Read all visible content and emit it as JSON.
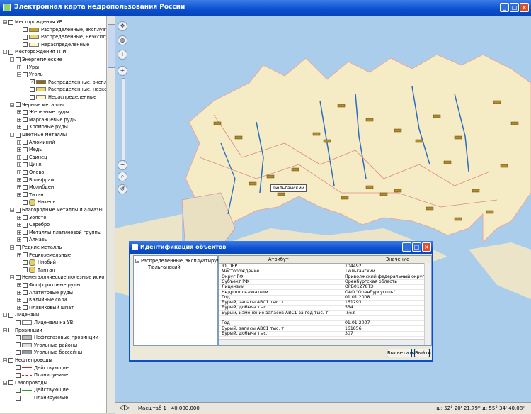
{
  "window": {
    "title": "Электронная карта недропользования России"
  },
  "tree": [
    {
      "label": "Месторождения УВ",
      "level": 0,
      "exp": "−"
    },
    {
      "label": "Распределенные, эксплуатируемые",
      "level": 2,
      "swatch": "#c9a020"
    },
    {
      "label": "Распределенные, неэксплуатируемые",
      "level": 2,
      "swatch": "#f0d860"
    },
    {
      "label": "Нераспределенные",
      "level": 2,
      "swatch": "#fff8c8"
    },
    {
      "label": "Месторождения ТПИ",
      "level": 0,
      "exp": "−"
    },
    {
      "label": "Энергетические",
      "level": 1,
      "exp": "−"
    },
    {
      "label": "Уран",
      "level": 2,
      "exp": "+"
    },
    {
      "label": "Уголь",
      "level": 2,
      "exp": "−"
    },
    {
      "label": "Распределенные, эксплуатируемые",
      "level": 3,
      "swatch": "#8a6a1a",
      "checked": true
    },
    {
      "label": "Распределенные, неэксплуатируемые",
      "level": 3,
      "swatch": "#f0d860"
    },
    {
      "label": "Нераспределенные",
      "level": 3,
      "swatch": "#fff8c8"
    },
    {
      "label": "Черные металлы",
      "level": 1,
      "exp": "−"
    },
    {
      "label": "Железные руды",
      "level": 2,
      "exp": "+"
    },
    {
      "label": "Марганцевые руды",
      "level": 2,
      "exp": "+"
    },
    {
      "label": "Хромовые руды",
      "level": 2,
      "exp": "+"
    },
    {
      "label": "Цветные металлы",
      "level": 1,
      "exp": "−"
    },
    {
      "label": "Алюминий",
      "level": 2,
      "exp": "+"
    },
    {
      "label": "Медь",
      "level": 2,
      "exp": "+"
    },
    {
      "label": "Свинец",
      "level": 2,
      "exp": "+"
    },
    {
      "label": "Цинк",
      "level": 2,
      "exp": "+"
    },
    {
      "label": "Олово",
      "level": 2,
      "exp": "+"
    },
    {
      "label": "Вольфрам",
      "level": 2,
      "exp": "+"
    },
    {
      "label": "Молибден",
      "level": 2,
      "exp": "+"
    },
    {
      "label": "Титан",
      "level": 2,
      "exp": "+"
    },
    {
      "label": "Никель",
      "level": 2,
      "swatch": "#e8d060",
      "round": true
    },
    {
      "label": "Благородные металлы и алмазы",
      "level": 1,
      "exp": "−"
    },
    {
      "label": "Золото",
      "level": 2,
      "exp": "+"
    },
    {
      "label": "Серебро",
      "level": 2,
      "exp": "+"
    },
    {
      "label": "Металлы платиновой группы",
      "level": 2,
      "exp": "+"
    },
    {
      "label": "Алмазы",
      "level": 2,
      "exp": "+"
    },
    {
      "label": "Редкие металлы",
      "level": 1,
      "exp": "−"
    },
    {
      "label": "Редкоземельные",
      "level": 2,
      "exp": "+"
    },
    {
      "label": "Ниобий",
      "level": 2,
      "swatch": "#e8d060",
      "round": true
    },
    {
      "label": "Тантал",
      "level": 2,
      "swatch": "#e8d060",
      "round": true
    },
    {
      "label": "Неметаллические полезные ископаемые",
      "level": 1,
      "exp": "−"
    },
    {
      "label": "Фосфоритовые руды",
      "level": 2,
      "exp": "+"
    },
    {
      "label": "Апатитовые руды",
      "level": 2,
      "exp": "+"
    },
    {
      "label": "Калийные соли",
      "level": 2,
      "exp": "+"
    },
    {
      "label": "Плавиковый шпат",
      "level": 2,
      "exp": "+"
    },
    {
      "label": "Лицензии",
      "level": 0,
      "exp": "−"
    },
    {
      "label": "Лицензии на УВ",
      "level": 1,
      "swatch": "#ffffff"
    },
    {
      "label": "Провинции",
      "level": 0,
      "exp": "−"
    },
    {
      "label": "Нефтегазовые провинции",
      "level": 1,
      "swatch": "#bbbbbb"
    },
    {
      "label": "Угольные районы",
      "level": 1,
      "swatch": "#e0e0e0"
    },
    {
      "label": "Угольные бассейны",
      "level": 1,
      "swatch": "#999999"
    },
    {
      "label": "Нефтепроводы",
      "level": 0,
      "exp": "−"
    },
    {
      "label": "Действующие",
      "level": 1,
      "line": "#cc2222"
    },
    {
      "label": "Планируемые",
      "level": 1,
      "line": "#cc2222",
      "dashed": true
    },
    {
      "label": "Газопроводы",
      "level": 0,
      "exp": "−"
    },
    {
      "label": "Действующие",
      "level": 1,
      "line": "#2a9a2a"
    },
    {
      "label": "Планируемые",
      "level": 1,
      "line": "#2a9a2a",
      "dashed": true
    }
  ],
  "map": {
    "popup_label": "Тюльганский"
  },
  "tools": {
    "pan": "✥",
    "globe": "◍",
    "info": "i",
    "zoom_in": "+",
    "zoom_out": "−",
    "search": "⌕",
    "back": "↺"
  },
  "status": {
    "scale": "Масштаб 1 : 40.000.000",
    "coords": "ш: 52° 20' 21,79'' д: 55° 34' 40,08''"
  },
  "dialog": {
    "title": "Идентификация объектов",
    "tree_node": "Распределенные, эксплуатируемые",
    "tree_child": "Тюльганский",
    "col_attr": "Атрибут",
    "col_val": "Значение",
    "rows": [
      [
        "ID_DEP",
        "104492"
      ],
      [
        "Месторождение",
        "Тюльганский"
      ],
      [
        "Округ РФ",
        "Приволжский федеральный округ"
      ],
      [
        "Субъект РФ",
        "Оренбургская область"
      ],
      [
        "Лицензии",
        "ОРБ01278ТЭ"
      ],
      [
        "Недропользователи",
        "ОАО \"Оренбургуголь\""
      ],
      [
        "Год",
        "01.01.2008"
      ],
      [
        "Бурый, запасы АВС1 тыс. т",
        "161293"
      ],
      [
        "Бурый, добыча тыс. т",
        "534"
      ],
      [
        "Бурый, изменение запасов АВС1 за год тыс. т",
        "-563"
      ],
      [
        "",
        ""
      ],
      [
        "Год",
        "01.01.2007"
      ],
      [
        "Бурый, запасы АВС1 тыс. т",
        "161856"
      ],
      [
        "Бурый, добыча тыс. т",
        "307"
      ]
    ],
    "btn_highlight": "Высветить",
    "btn_exit": "Выйти"
  }
}
